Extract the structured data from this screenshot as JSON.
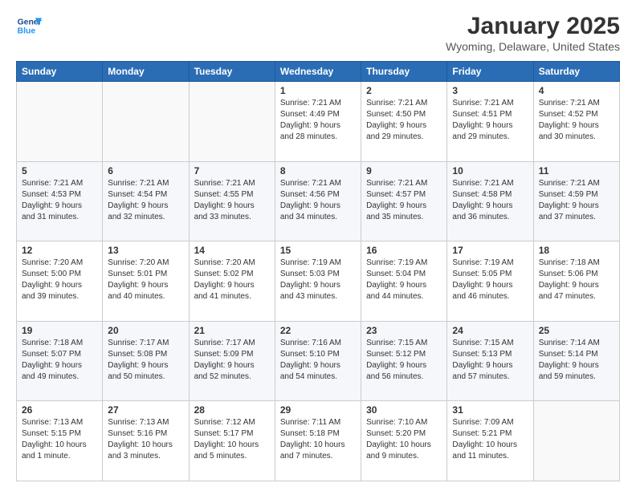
{
  "header": {
    "logo_line1": "General",
    "logo_line2": "Blue",
    "title": "January 2025",
    "subtitle": "Wyoming, Delaware, United States"
  },
  "calendar": {
    "days_of_week": [
      "Sunday",
      "Monday",
      "Tuesday",
      "Wednesday",
      "Thursday",
      "Friday",
      "Saturday"
    ],
    "weeks": [
      [
        {
          "day": "",
          "info": ""
        },
        {
          "day": "",
          "info": ""
        },
        {
          "day": "",
          "info": ""
        },
        {
          "day": "1",
          "info": "Sunrise: 7:21 AM\nSunset: 4:49 PM\nDaylight: 9 hours\nand 28 minutes."
        },
        {
          "day": "2",
          "info": "Sunrise: 7:21 AM\nSunset: 4:50 PM\nDaylight: 9 hours\nand 29 minutes."
        },
        {
          "day": "3",
          "info": "Sunrise: 7:21 AM\nSunset: 4:51 PM\nDaylight: 9 hours\nand 29 minutes."
        },
        {
          "day": "4",
          "info": "Sunrise: 7:21 AM\nSunset: 4:52 PM\nDaylight: 9 hours\nand 30 minutes."
        }
      ],
      [
        {
          "day": "5",
          "info": "Sunrise: 7:21 AM\nSunset: 4:53 PM\nDaylight: 9 hours\nand 31 minutes."
        },
        {
          "day": "6",
          "info": "Sunrise: 7:21 AM\nSunset: 4:54 PM\nDaylight: 9 hours\nand 32 minutes."
        },
        {
          "day": "7",
          "info": "Sunrise: 7:21 AM\nSunset: 4:55 PM\nDaylight: 9 hours\nand 33 minutes."
        },
        {
          "day": "8",
          "info": "Sunrise: 7:21 AM\nSunset: 4:56 PM\nDaylight: 9 hours\nand 34 minutes."
        },
        {
          "day": "9",
          "info": "Sunrise: 7:21 AM\nSunset: 4:57 PM\nDaylight: 9 hours\nand 35 minutes."
        },
        {
          "day": "10",
          "info": "Sunrise: 7:21 AM\nSunset: 4:58 PM\nDaylight: 9 hours\nand 36 minutes."
        },
        {
          "day": "11",
          "info": "Sunrise: 7:21 AM\nSunset: 4:59 PM\nDaylight: 9 hours\nand 37 minutes."
        }
      ],
      [
        {
          "day": "12",
          "info": "Sunrise: 7:20 AM\nSunset: 5:00 PM\nDaylight: 9 hours\nand 39 minutes."
        },
        {
          "day": "13",
          "info": "Sunrise: 7:20 AM\nSunset: 5:01 PM\nDaylight: 9 hours\nand 40 minutes."
        },
        {
          "day": "14",
          "info": "Sunrise: 7:20 AM\nSunset: 5:02 PM\nDaylight: 9 hours\nand 41 minutes."
        },
        {
          "day": "15",
          "info": "Sunrise: 7:19 AM\nSunset: 5:03 PM\nDaylight: 9 hours\nand 43 minutes."
        },
        {
          "day": "16",
          "info": "Sunrise: 7:19 AM\nSunset: 5:04 PM\nDaylight: 9 hours\nand 44 minutes."
        },
        {
          "day": "17",
          "info": "Sunrise: 7:19 AM\nSunset: 5:05 PM\nDaylight: 9 hours\nand 46 minutes."
        },
        {
          "day": "18",
          "info": "Sunrise: 7:18 AM\nSunset: 5:06 PM\nDaylight: 9 hours\nand 47 minutes."
        }
      ],
      [
        {
          "day": "19",
          "info": "Sunrise: 7:18 AM\nSunset: 5:07 PM\nDaylight: 9 hours\nand 49 minutes."
        },
        {
          "day": "20",
          "info": "Sunrise: 7:17 AM\nSunset: 5:08 PM\nDaylight: 9 hours\nand 50 minutes."
        },
        {
          "day": "21",
          "info": "Sunrise: 7:17 AM\nSunset: 5:09 PM\nDaylight: 9 hours\nand 52 minutes."
        },
        {
          "day": "22",
          "info": "Sunrise: 7:16 AM\nSunset: 5:10 PM\nDaylight: 9 hours\nand 54 minutes."
        },
        {
          "day": "23",
          "info": "Sunrise: 7:15 AM\nSunset: 5:12 PM\nDaylight: 9 hours\nand 56 minutes."
        },
        {
          "day": "24",
          "info": "Sunrise: 7:15 AM\nSunset: 5:13 PM\nDaylight: 9 hours\nand 57 minutes."
        },
        {
          "day": "25",
          "info": "Sunrise: 7:14 AM\nSunset: 5:14 PM\nDaylight: 9 hours\nand 59 minutes."
        }
      ],
      [
        {
          "day": "26",
          "info": "Sunrise: 7:13 AM\nSunset: 5:15 PM\nDaylight: 10 hours\nand 1 minute."
        },
        {
          "day": "27",
          "info": "Sunrise: 7:13 AM\nSunset: 5:16 PM\nDaylight: 10 hours\nand 3 minutes."
        },
        {
          "day": "28",
          "info": "Sunrise: 7:12 AM\nSunset: 5:17 PM\nDaylight: 10 hours\nand 5 minutes."
        },
        {
          "day": "29",
          "info": "Sunrise: 7:11 AM\nSunset: 5:18 PM\nDaylight: 10 hours\nand 7 minutes."
        },
        {
          "day": "30",
          "info": "Sunrise: 7:10 AM\nSunset: 5:20 PM\nDaylight: 10 hours\nand 9 minutes."
        },
        {
          "day": "31",
          "info": "Sunrise: 7:09 AM\nSunset: 5:21 PM\nDaylight: 10 hours\nand 11 minutes."
        },
        {
          "day": "",
          "info": ""
        }
      ]
    ]
  }
}
